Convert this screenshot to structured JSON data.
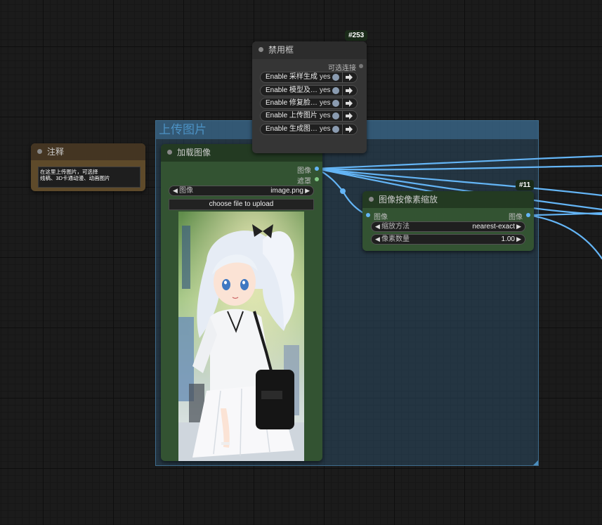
{
  "group": {
    "title": "上传图片"
  },
  "note_node": {
    "title": "注释",
    "text": "在这里上传图片，可选择\n线稿、3D卡通动漫、动画图片"
  },
  "load_node": {
    "title": "加载图像",
    "outputs": [
      "图像",
      "遮罩"
    ],
    "image_widget": {
      "label": "图像",
      "value": "image.png"
    },
    "upload_label": "choose file to upload"
  },
  "mute_node": {
    "badge": "#253",
    "title": "禁用框",
    "output_label": "可选连接",
    "toggles": [
      {
        "label": "Enable 采样生成",
        "value": "yes"
      },
      {
        "label": "Enable 模型及…",
        "value": "yes"
      },
      {
        "label": "Enable 修复脸…",
        "value": "yes"
      },
      {
        "label": "Enable 上传图片",
        "value": "yes"
      },
      {
        "label": "Enable 生成图…",
        "value": "yes"
      }
    ]
  },
  "scale_node": {
    "badge": "#11",
    "title": "图像按像素缩放",
    "input_label": "图像",
    "output_label": "图像",
    "widgets": [
      {
        "label": "缩放方法",
        "value": "nearest-exact"
      },
      {
        "label": "像素数量",
        "value": "1.00"
      }
    ]
  },
  "colors": {
    "image_link": "#64b5f6",
    "mask_link": "#81c784"
  }
}
